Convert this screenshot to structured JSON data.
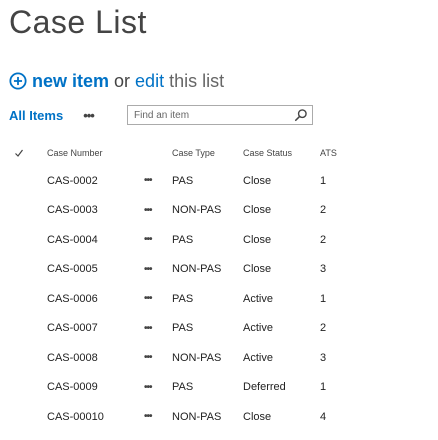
{
  "page": {
    "title": "Case List"
  },
  "actions": {
    "new_item_label": "new item",
    "or_text": "or",
    "edit_label": "edit",
    "this_list_text": "this list",
    "plus_icon": "circle-plus-icon"
  },
  "view": {
    "current_view": "All Items",
    "more_label": "•••"
  },
  "search": {
    "placeholder": "Find an item",
    "icon": "search-icon"
  },
  "table": {
    "columns": {
      "number": "Case Number",
      "type": "Case Type",
      "status": "Case Status",
      "ats": "ATS"
    },
    "rows": [
      {
        "number": "CAS-0002",
        "ellipsis": "•••",
        "type": "PAS",
        "status": "Close",
        "ats": "1"
      },
      {
        "number": "CAS-0003",
        "ellipsis": "•••",
        "type": "NON-PAS",
        "status": "Close",
        "ats": "2"
      },
      {
        "number": "CAS-0004",
        "ellipsis": "•••",
        "type": "PAS",
        "status": "Close",
        "ats": "2"
      },
      {
        "number": "CAS-0005",
        "ellipsis": "•••",
        "type": "NON-PAS",
        "status": "Close",
        "ats": "3"
      },
      {
        "number": "CAS-0006",
        "ellipsis": "•••",
        "type": "PAS",
        "status": "Active",
        "ats": "1"
      },
      {
        "number": "CAS-0007",
        "ellipsis": "•••",
        "type": "PAS",
        "status": "Active",
        "ats": "2"
      },
      {
        "number": "CAS-0008",
        "ellipsis": "•••",
        "type": "NON-PAS",
        "status": "Active",
        "ats": "3"
      },
      {
        "number": "CAS-0009",
        "ellipsis": "•••",
        "type": "PAS",
        "status": "Deferred",
        "ats": "1"
      },
      {
        "number": "CAS-00010",
        "ellipsis": "•••",
        "type": "NON-PAS",
        "status": "Close",
        "ats": "4"
      }
    ]
  },
  "colors": {
    "accent": "#0072c6",
    "text": "#222222",
    "muted": "#666666"
  }
}
